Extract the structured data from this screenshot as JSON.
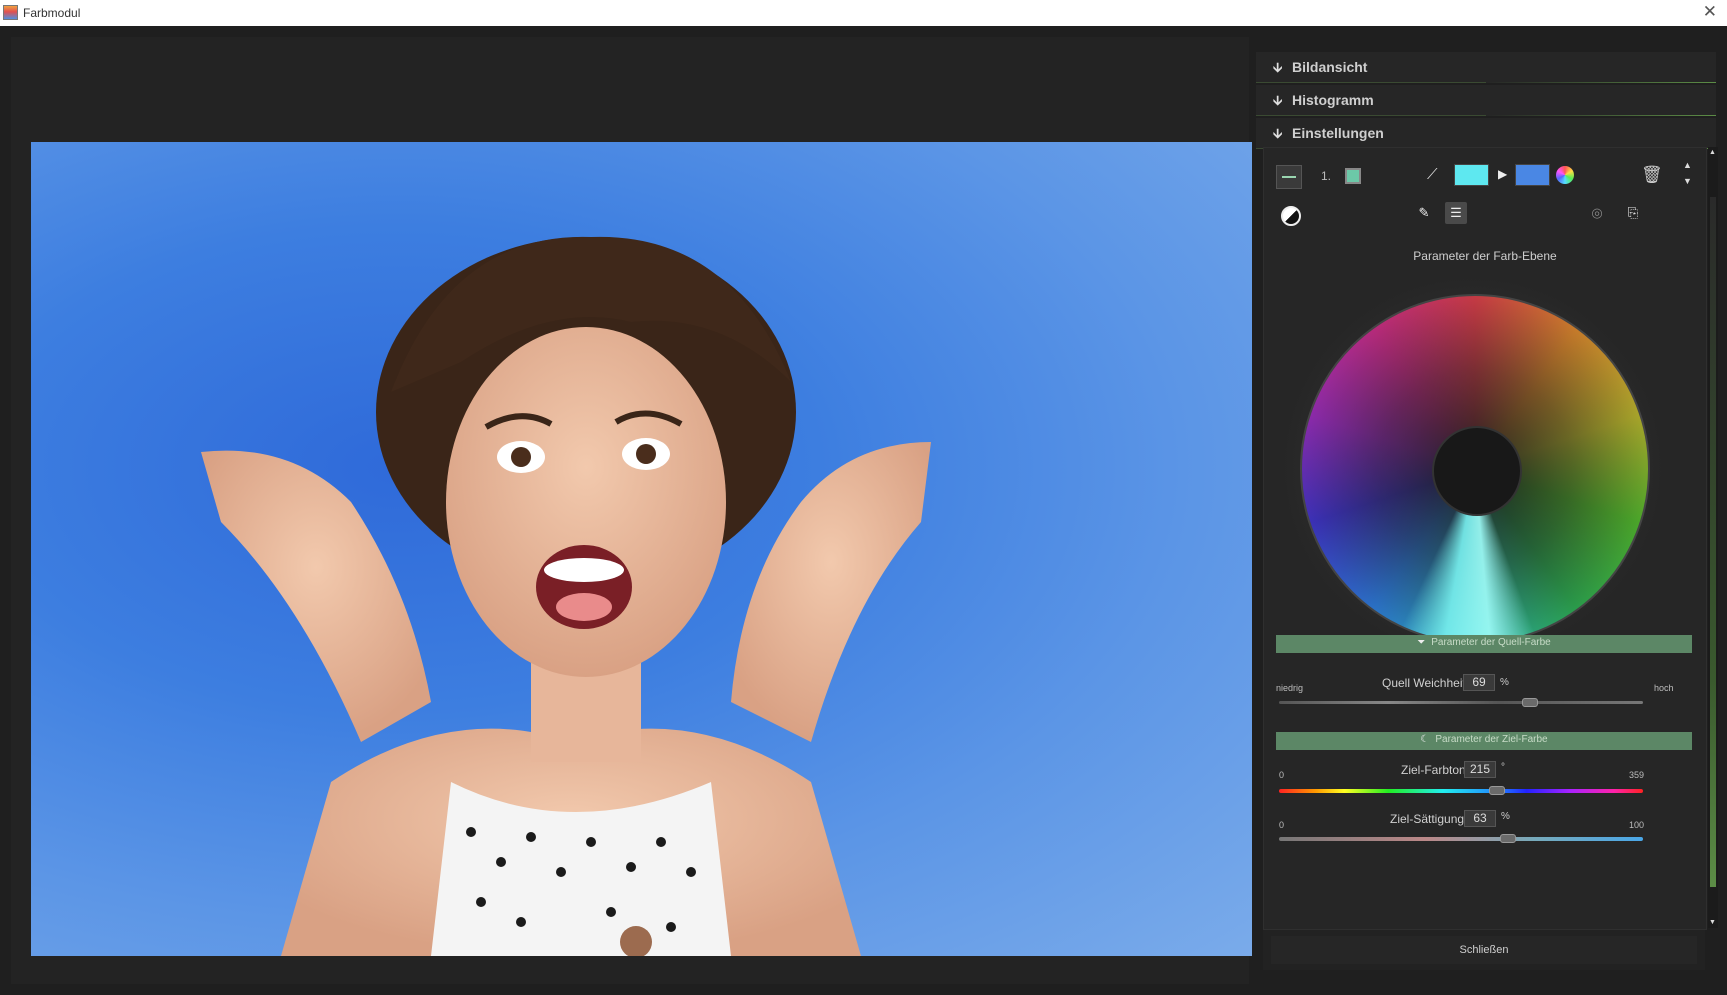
{
  "window": {
    "title": "Farbmodul",
    "close_glyph": "✕"
  },
  "photo": {
    "description": "Frau mit überraschtem Gesichtsausdruck vor blauem Hintergrund"
  },
  "sections": [
    {
      "arrow": "🡫",
      "label": "Bildansicht"
    },
    {
      "arrow": "🡫",
      "label": "Histogramm"
    },
    {
      "arrow": "🡫",
      "label": "Einstellungen"
    }
  ],
  "layer": {
    "number": "1.",
    "color": "#6cc8a8",
    "source_color": "#5ee8f0",
    "target_color": "#4a87e4",
    "arrow": "▶"
  },
  "params_title": "Parameter der Farb-Ebene",
  "source_params": {
    "bar_label": "Parameter der Quell-Farbe",
    "bar_icon": "⏷",
    "softness": {
      "label": "Quell Weichheit",
      "value": "69",
      "unit": "%",
      "min_label": "niedrig",
      "max_label": "hoch",
      "fraction": 0.69
    }
  },
  "target_params": {
    "bar_label": "Parameter der Ziel-Farbe",
    "bar_icon": "☾",
    "hue": {
      "label": "Ziel-Farbton",
      "value": "215",
      "unit": "°",
      "min_label": "0",
      "max_label": "359",
      "fraction": 0.599
    },
    "saturation": {
      "label": "Ziel-Sättigung",
      "value": "63",
      "unit": "%",
      "min_label": "0",
      "max_label": "100",
      "fraction": 0.63
    }
  },
  "footer": {
    "close_label": "Schließen"
  },
  "colors": {
    "accent": "#5c8766",
    "background": "#1f1f1f",
    "panel": "#262626"
  }
}
